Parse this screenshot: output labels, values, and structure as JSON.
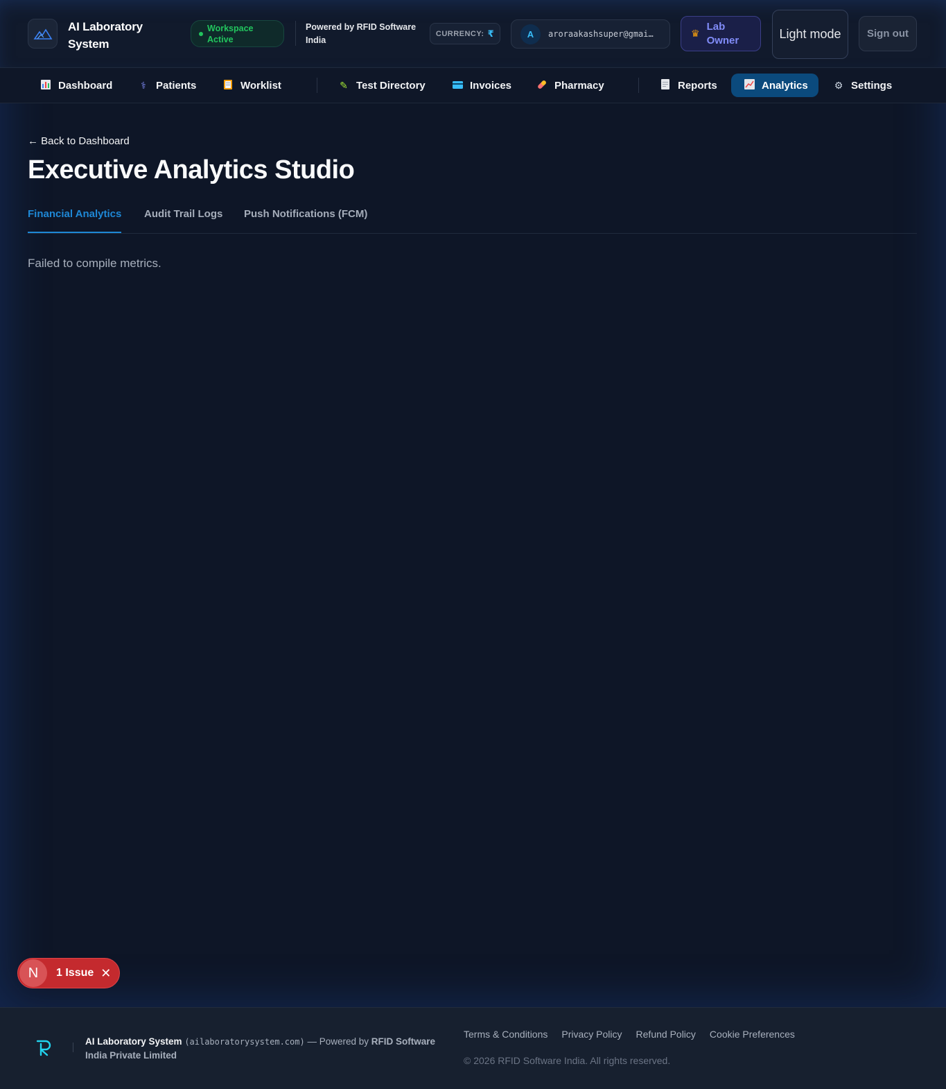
{
  "header": {
    "brand": "AI Laboratory System",
    "workspace_status": "Workspace Active",
    "powered_by": "Powered by RFID Software India",
    "currency_label": "CURRENCY:",
    "currency_symbol": "₹",
    "user_initial": "A",
    "user_email": "aroraakashsuper@gmai…",
    "role": "Lab Owner",
    "theme_toggle": "Light mode",
    "sign_out": "Sign out"
  },
  "nav": {
    "items": [
      {
        "label": "Dashboard",
        "icon": "bar-chart-icon"
      },
      {
        "label": "Patients",
        "icon": "stethoscope-icon"
      },
      {
        "label": "Worklist",
        "icon": "clipboard-icon"
      },
      {
        "label": "Test Directory",
        "icon": "test-tube-icon"
      },
      {
        "label": "Invoices",
        "icon": "credit-card-icon"
      },
      {
        "label": "Pharmacy",
        "icon": "pill-icon"
      },
      {
        "label": "Reports",
        "icon": "document-icon"
      },
      {
        "label": "Analytics",
        "icon": "line-chart-icon",
        "active": true
      },
      {
        "label": "Settings",
        "icon": "gear-icon"
      }
    ]
  },
  "main": {
    "back_link": "← Back to Dashboard",
    "title": "Executive Analytics Studio",
    "tabs": [
      {
        "label": "Financial Analytics",
        "active": true
      },
      {
        "label": "Audit Trail Logs"
      },
      {
        "label": "Push Notifications (FCM)"
      }
    ],
    "error_message": "Failed to compile metrics."
  },
  "issue_badge": {
    "initial": "N",
    "label": "1 Issue",
    "close": "✕"
  },
  "footer": {
    "brand": "AI Laboratory System",
    "domain": "(ailaboratorysystem.com)",
    "powered_prefix": "— Powered by",
    "company": "RFID Software India Private Limited",
    "links": [
      "Terms & Conditions",
      "Privacy Policy",
      "Refund Policy",
      "Cookie Preferences"
    ],
    "copyright": "© 2026 RFID Software India. All rights reserved."
  },
  "colors": {
    "background": "#0e1627",
    "accent": "#1e88d6",
    "active_nav": "#0b4a7d",
    "success": "#22c55e",
    "role": "#818cf8",
    "issue": "#c42a2e"
  }
}
